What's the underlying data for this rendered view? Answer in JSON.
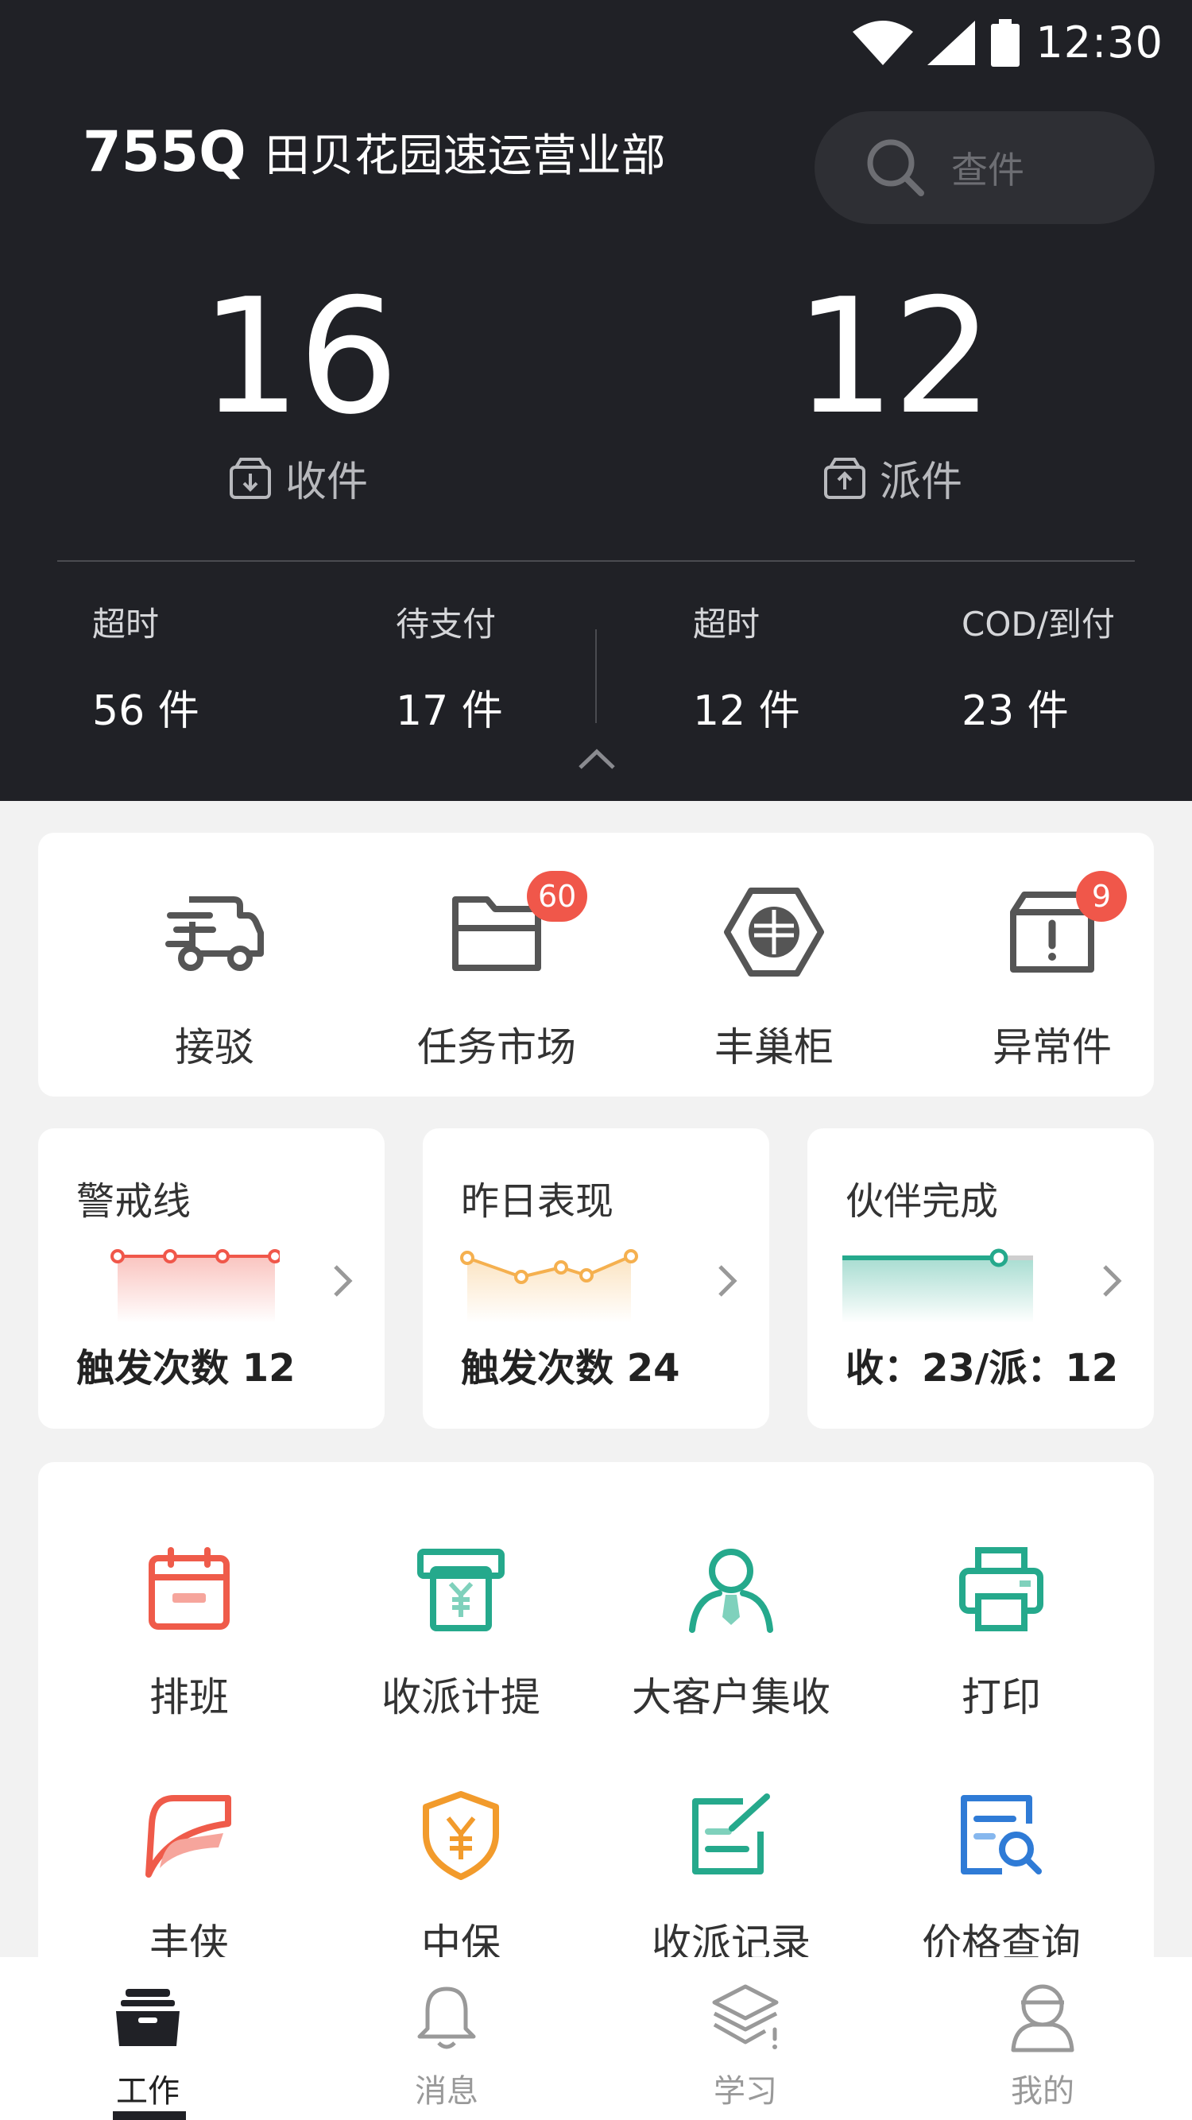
{
  "status_bar": {
    "time": "12:30"
  },
  "header": {
    "dept_code": "755Q",
    "dept_name": "田贝花园速运营业部",
    "search_placeholder": "查件",
    "receive": {
      "count": "16",
      "label": "收件"
    },
    "dispatch": {
      "count": "12",
      "label": "派件"
    },
    "sub_stats": [
      {
        "label": "超时",
        "value": "56 件"
      },
      {
        "label": "待支付",
        "value": "17 件"
      },
      {
        "label": "超时",
        "value": "12 件"
      },
      {
        "label": "COD/到付",
        "value": "23 件"
      }
    ]
  },
  "quick_actions": [
    {
      "label": "接驳",
      "icon": "truck-icon"
    },
    {
      "label": "任务市场",
      "icon": "folder-icon",
      "badge": "60"
    },
    {
      "label": "丰巢柜",
      "icon": "locker-icon"
    },
    {
      "label": "异常件",
      "icon": "exception-box-icon",
      "badge": "9"
    }
  ],
  "mini_cards": [
    {
      "title": "警戒线",
      "value": "触发次数 12",
      "color": "#f0574a"
    },
    {
      "title": "昨日表现",
      "value": "触发次数 24",
      "color": "#f5b04f"
    },
    {
      "title": "伙伴完成",
      "value": "收：23/派：12",
      "color": "#25a98c",
      "progress": 0.82
    }
  ],
  "tools": [
    {
      "label": "排班",
      "icon": "calendar-icon",
      "color": "#ef5b4a"
    },
    {
      "label": "收派计提",
      "icon": "payment-icon",
      "color": "#25a98c"
    },
    {
      "label": "大客户集收",
      "icon": "customer-icon",
      "color": "#25a98c"
    },
    {
      "label": "打印",
      "icon": "printer-icon",
      "color": "#25a98c"
    },
    {
      "label": "丰侠",
      "icon": "fengxia-icon",
      "color": "#ef5b4a"
    },
    {
      "label": "中保",
      "icon": "insurance-shield-icon",
      "color": "#f29b2c"
    },
    {
      "label": "收派记录",
      "icon": "record-edit-icon",
      "color": "#25a98c"
    },
    {
      "label": "价格查询",
      "icon": "price-search-icon",
      "color": "#2f7bd6"
    }
  ],
  "tabs": [
    {
      "label": "工作",
      "icon": "work-icon",
      "active": true
    },
    {
      "label": "消息",
      "icon": "bell-icon"
    },
    {
      "label": "学习",
      "icon": "learn-icon"
    },
    {
      "label": "我的",
      "icon": "profile-icon"
    }
  ]
}
